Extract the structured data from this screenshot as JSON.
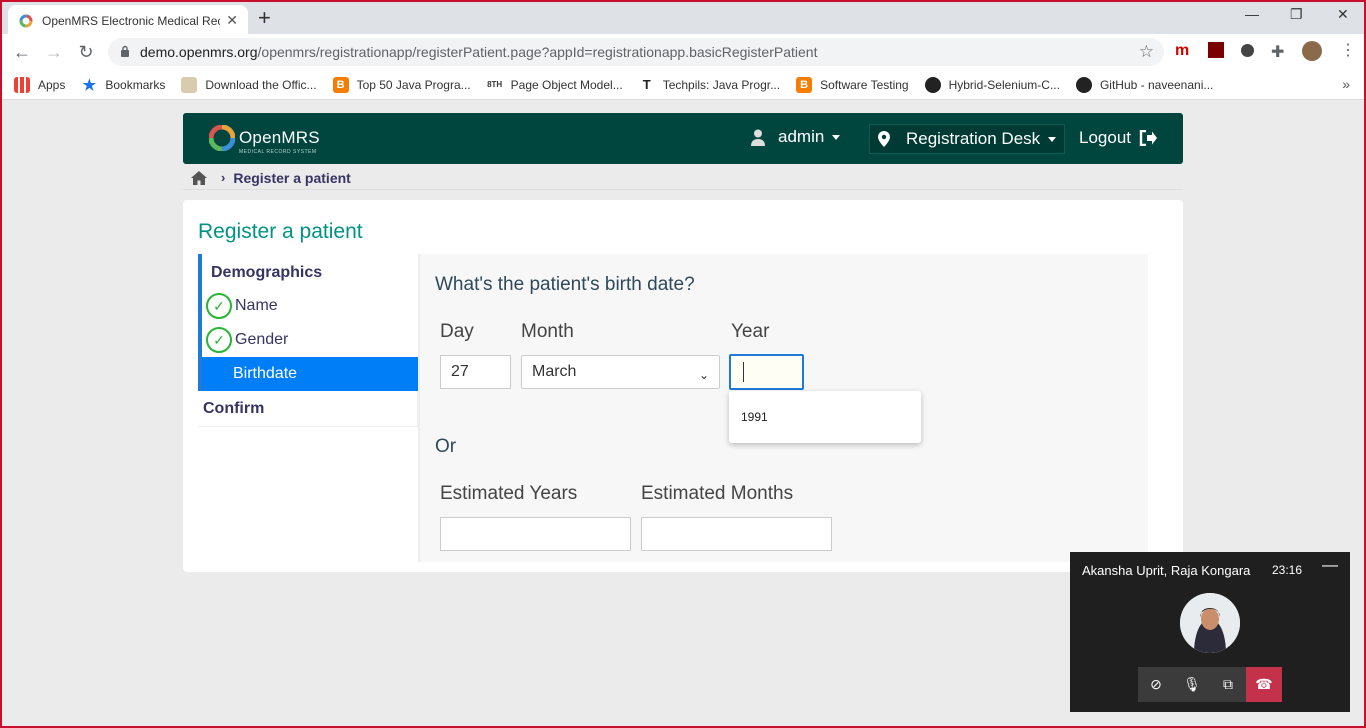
{
  "browser": {
    "tab_title": "OpenMRS Electronic Medical Rec",
    "tab_close": "✕",
    "new_tab": "+",
    "window_controls": [
      "—",
      "❐",
      "✕"
    ],
    "url_host": "demo.openmrs.org",
    "url_path": "/openmrs/registrationapp/registerPatient.page?appId=registrationapp.basicRegisterPatient",
    "bookmarks": [
      {
        "label": "Apps",
        "icon": "apps-grid-icon"
      },
      {
        "label": "Bookmarks",
        "icon": "star-icon"
      },
      {
        "label": "Download the Offic...",
        "icon": "page-icon"
      },
      {
        "label": "Top 50 Java Progra...",
        "icon": "blogger-icon"
      },
      {
        "label": "Page Object Model...",
        "icon": "8th-icon"
      },
      {
        "label": "Techpils: Java Progr...",
        "icon": "t-icon"
      },
      {
        "label": "Software Testing",
        "icon": "blogger-icon"
      },
      {
        "label": "Hybrid-Selenium-C...",
        "icon": "github-icon"
      },
      {
        "label": "GitHub - naveenani...",
        "icon": "github-icon"
      }
    ],
    "bookmarks_more": "»"
  },
  "header": {
    "logo_text": "OpenMRS",
    "logo_subtitle": "MEDICAL RECORD SYSTEM",
    "user": "admin",
    "location": "Registration Desk",
    "logout": "Logout"
  },
  "breadcrumb": {
    "current": "Register a patient"
  },
  "page": {
    "title": "Register a patient",
    "steps": {
      "section": "Demographics",
      "name": "Name",
      "gender": "Gender",
      "birthdate": "Birthdate",
      "confirm": "Confirm"
    },
    "question": "What's the patient's birth date?",
    "day_label": "Day",
    "month_label": "Month",
    "year_label": "Year",
    "day_value": "27",
    "month_value": "March",
    "year_value": "",
    "autocomplete_option": "1991",
    "or_label": "Or",
    "est_years_label": "Estimated Years",
    "est_months_label": "Estimated Months",
    "est_years_value": "",
    "est_months_value": ""
  },
  "call": {
    "names": "Akansha Uprit, Raja Kongara",
    "time": "23:16",
    "minimize": "—"
  },
  "colors": {
    "header_bg": "#00463f",
    "title_teal": "#009384",
    "active_step": "#007ef7",
    "check_green": "#28b434",
    "end_call": "#c4314b"
  }
}
